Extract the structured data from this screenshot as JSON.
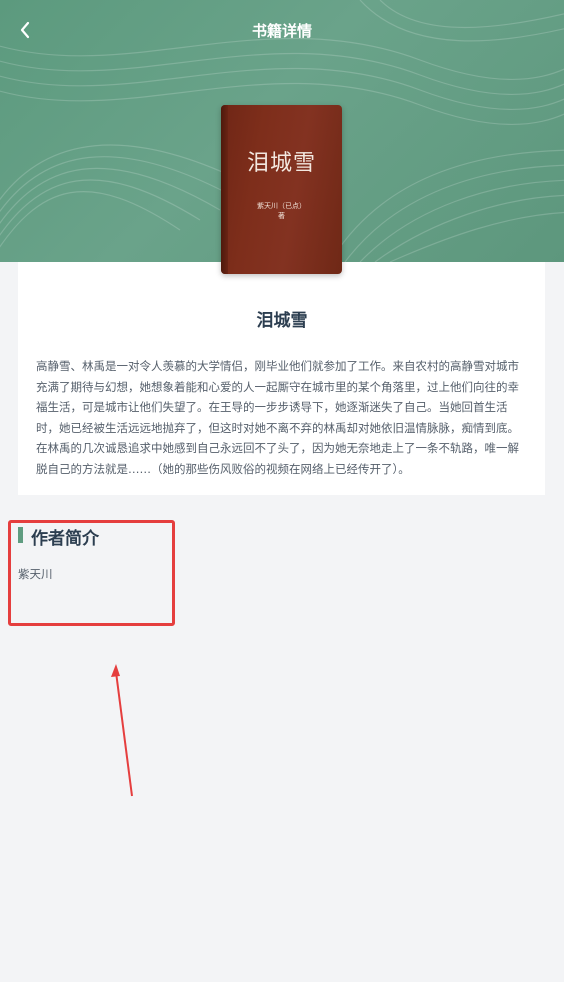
{
  "header": {
    "title": "书籍详情",
    "back_icon": "chevron-left-icon",
    "background_color": "#5f9c80"
  },
  "book": {
    "cover_title": "泪城雪",
    "cover_author": "紫天川（已点）",
    "cover_author_suffix": "著",
    "cover_color": "#7e2e1b",
    "name": "泪城雪",
    "description": "高静雪、林禹是一对令人羡慕的大学情侣，刚毕业他们就参加了工作。来自农村的高静雪对城市充满了期待与幻想，她想象着能和心爱的人一起厮守在城市里的某个角落里，过上他们向往的幸福生活，可是城市让他们失望了。在王导的一步步诱导下，她逐渐迷失了自己。当她回首生活时，她已经被生活远远地抛弃了，但这时对她不离不弃的林禹却对她依旧温情脉脉，痴情到底。在林禹的几次诚恳追求中她感到自己永远回不了头了，因为她无奈地走上了一条不轨路，唯一解脱自己的方法就是……（她的那些伤风败俗的视频在网络上已经传开了）。"
  },
  "author_section": {
    "title": "作者简介",
    "accent_color": "#5f9c80",
    "content": "紫天川"
  },
  "annotation": {
    "color": "#e53e3e"
  }
}
